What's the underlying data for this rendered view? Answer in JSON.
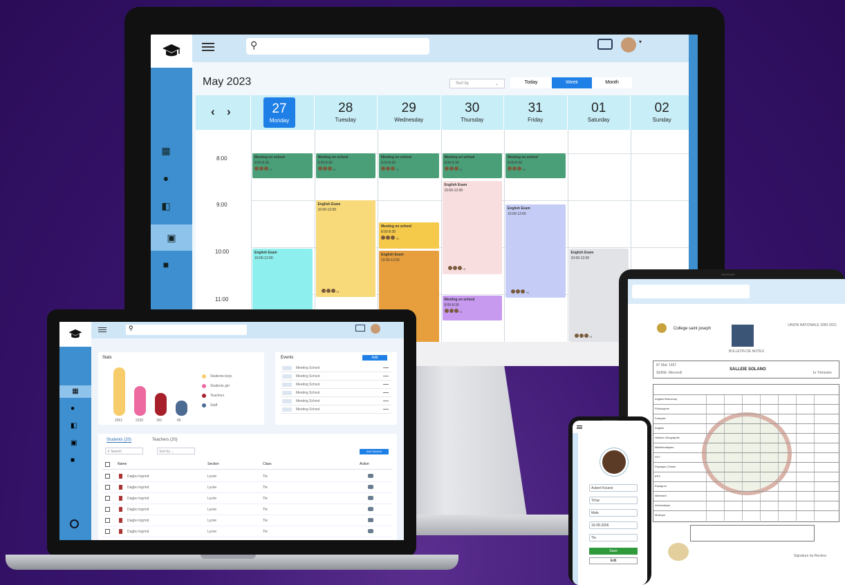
{
  "monitor": {
    "month_label": "May 2023",
    "sort_by": "Sort by",
    "view_buttons": [
      "Today",
      "Week",
      "Month"
    ],
    "days": [
      {
        "num": "27",
        "name": "Monday",
        "active": true
      },
      {
        "num": "28",
        "name": "Tuesday"
      },
      {
        "num": "29",
        "name": "Wednesday"
      },
      {
        "num": "30",
        "name": "Thursday"
      },
      {
        "num": "31",
        "name": "Friday"
      },
      {
        "num": "01",
        "name": "Saturday"
      },
      {
        "num": "02",
        "name": "Sunday"
      }
    ],
    "times": [
      "8:00",
      "9:00",
      "10:00",
      "11:00"
    ],
    "event_meeting": "Meeting on school",
    "event_exam": "English Exam",
    "event_time": "8:00-8:30",
    "exam_time": "10:00-12:00",
    "more": "+3",
    "colors": {
      "accent": "#1e7fe6",
      "sidebar": "#3d8fd0",
      "meeting": "#4a9f78",
      "exam_yellow": "#f8da7a",
      "exam_orange": "#e79f3d",
      "exam_pink": "#f8dede",
      "exam_blue": "#c5cdf6",
      "exam_cyan": "#8ef0ee",
      "exam_grey": "#e1e3e6",
      "meeting_purple": "#c79af0",
      "meeting_yellow": "#f5c94a"
    }
  },
  "laptop": {
    "stats_title": "Stats",
    "bar_labels": [
      "2551",
      "2220",
      "391",
      "85"
    ],
    "legend": [
      "Students boys",
      "Students girl",
      "Teachers",
      "Staff"
    ],
    "events_title": "Events",
    "events_button": "Add",
    "events": [
      "Meeting School",
      "Meeting School",
      "Meeting School",
      "Meeting School",
      "Meeting School",
      "Meeting School"
    ],
    "tabs": [
      "Students (20)",
      "Teachers (20)"
    ],
    "search_placeholder": "Search",
    "sort_by": "Sort by",
    "add_button": "Add Student",
    "columns": [
      "Name",
      "Section",
      "Class",
      "Action"
    ],
    "rows": [
      {
        "name": "Dagbo Ingrind",
        "section": "Lycée",
        "class": "Tle"
      },
      {
        "name": "Dagbo Ingrind",
        "section": "Lycée",
        "class": "Tle"
      },
      {
        "name": "Dagbo Ingrind",
        "section": "Lycée",
        "class": "Tle"
      },
      {
        "name": "Dagbo Ingrind",
        "section": "Lycée",
        "class": "Tle"
      },
      {
        "name": "Dagbo Ingrind",
        "section": "Lycée",
        "class": "Tle"
      },
      {
        "name": "Dagbo Ingrind",
        "section": "Lycée",
        "class": "Tle"
      }
    ],
    "bar_values": [
      0.78,
      0.48,
      0.37,
      0.24
    ],
    "bar_colors": [
      "#f7cd6b",
      "#ec6aa0",
      "#a81f2c",
      "#4c6a92"
    ]
  },
  "tablet": {
    "school_name": "College saint joseph",
    "republic": "UNION NATIONALE 2000-2021",
    "bulletin": "BULLETIN DE NOTES",
    "student_name": "SALLEIE SOLANO",
    "matricule": "N° Mat: 1457",
    "serie": "SERIE: Mercredi",
    "trimestre": "1e Trimestre",
    "subjects": [
      "Anglais Beaucoup",
      "Philosophie",
      "Français",
      "Anglais",
      "Histoire-Géographie",
      "Mathématiques",
      "SVT",
      "Physique-Chimie",
      "EPS",
      "Espagnol",
      "Allemand",
      "Informatique",
      "Musique"
    ],
    "signature": "Signature du Recteur"
  },
  "phone": {
    "fields": [
      "Aubert Kouesi",
      "Tchar",
      "Male",
      "16-08-2006",
      "Tle"
    ],
    "save": "Save",
    "edit": "Edit"
  }
}
